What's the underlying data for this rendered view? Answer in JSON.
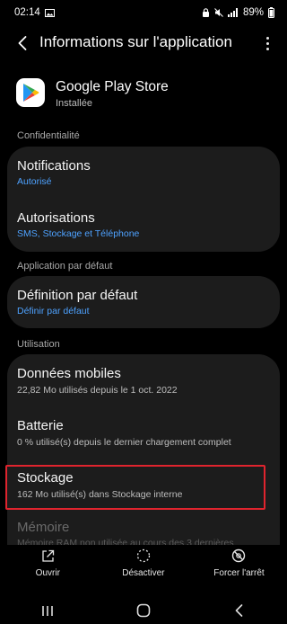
{
  "status_bar": {
    "time": "02:14",
    "battery": "89%",
    "icons": [
      "image-icon",
      "lock-icon",
      "mute-icon",
      "signal-icon",
      "battery-icon"
    ]
  },
  "app_bar": {
    "title": "Informations sur l'application",
    "back_icon": "back-arrow-icon",
    "more_icon": "more-vertical-icon"
  },
  "app": {
    "name": "Google Play Store",
    "status": "Installée",
    "icon": "google-play-icon"
  },
  "sections": {
    "privacy": "Confidentialité",
    "default_app": "Application par défaut",
    "usage": "Utilisation"
  },
  "rows": {
    "notifications": {
      "title": "Notifications",
      "sub": "Autorisé"
    },
    "permissions": {
      "title": "Autorisations",
      "sub": "SMS, Stockage et Téléphone"
    },
    "set_default": {
      "title": "Définition par défaut",
      "sub": "Définir par défaut"
    },
    "mobile_data": {
      "title": "Données mobiles",
      "sub": "22,82 Mo utilisés depuis le 1 oct. 2022"
    },
    "battery": {
      "title": "Batterie",
      "sub": "0 % utilisé(s) depuis le dernier chargement complet"
    },
    "storage": {
      "title": "Stockage",
      "sub": "162 Mo utilisé(s) dans Stockage interne"
    },
    "memory": {
      "title": "Mémoire",
      "sub": "Mémoire RAM non utilisée au cours des 3 dernières"
    }
  },
  "actions": {
    "open": {
      "label": "Ouvrir",
      "icon": "open-external-icon"
    },
    "disable": {
      "label": "Désactiver",
      "icon": "disable-circle-icon"
    },
    "force_stop": {
      "label": "Forcer l'arrêt",
      "icon": "stop-circle-icon"
    }
  },
  "nav": {
    "recents_icon": "recents-icon",
    "home_icon": "home-icon",
    "back_icon": "nav-back-icon"
  },
  "colors": {
    "background": "#000000",
    "card": "#1c1c1c",
    "accent_blue": "#4ea2ff",
    "highlight_red": "#e0242e"
  }
}
